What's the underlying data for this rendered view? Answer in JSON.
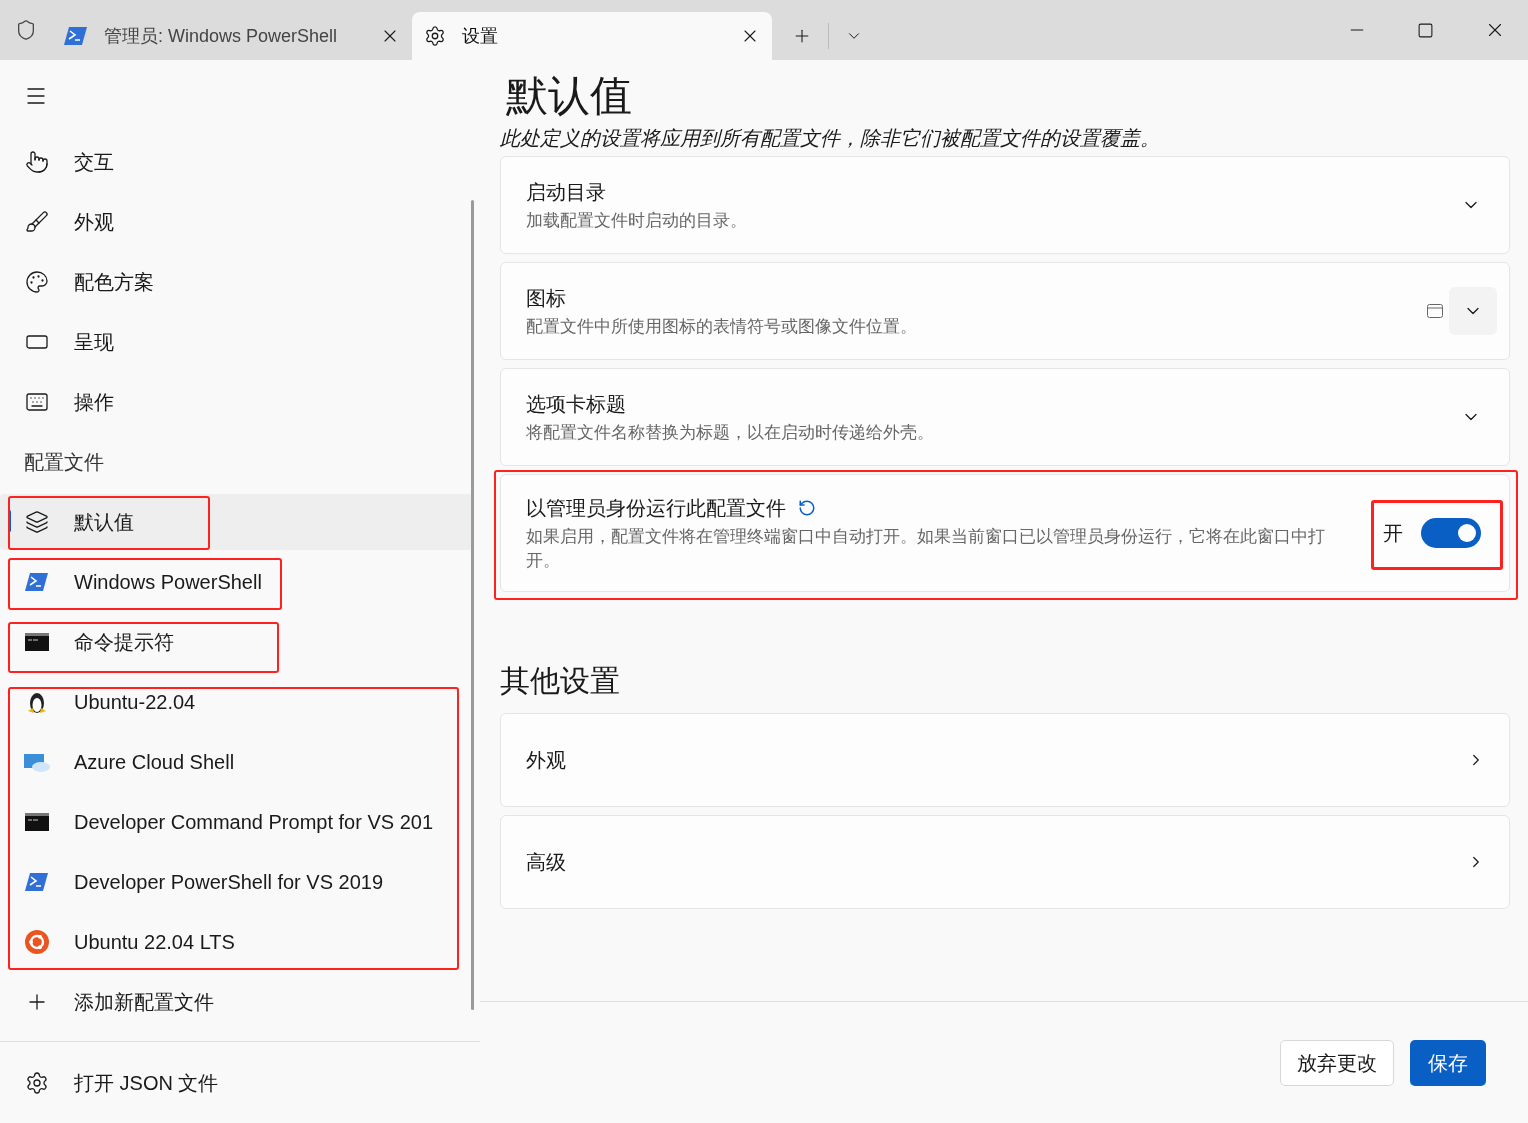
{
  "tabs": [
    {
      "kind": "powershell",
      "title": "管理员: Windows PowerShell",
      "selected": false
    },
    {
      "kind": "settings",
      "title": "设置",
      "selected": true
    }
  ],
  "sidebar": {
    "nav_items": [
      {
        "kind": "pointer",
        "label": "交互"
      },
      {
        "kind": "brush",
        "label": "外观"
      },
      {
        "kind": "palette",
        "label": "配色方案"
      },
      {
        "kind": "screen",
        "label": "呈现"
      },
      {
        "kind": "keyboard",
        "label": "操作"
      }
    ],
    "profiles_header": "配置文件",
    "profiles": [
      {
        "kind": "layers",
        "label": "默认值",
        "selected": true
      },
      {
        "kind": "powershell",
        "label": "Windows PowerShell",
        "selected": false
      },
      {
        "kind": "cmd",
        "label": "命令提示符",
        "selected": false
      },
      {
        "kind": "linux",
        "label": "Ubuntu-22.04",
        "selected": false
      },
      {
        "kind": "azure",
        "label": "Azure Cloud Shell",
        "selected": false
      },
      {
        "kind": "cmd",
        "label": "Developer Command Prompt for VS 201",
        "selected": false
      },
      {
        "kind": "powershell",
        "label": "Developer PowerShell for VS 2019",
        "selected": false
      },
      {
        "kind": "ubuntu",
        "label": "Ubuntu 22.04 LTS",
        "selected": false
      }
    ],
    "add_profile": "添加新配置文件",
    "open_json": "打开 JSON 文件"
  },
  "page": {
    "title": "默认值",
    "subtitle": "此处定义的设置将应用到所有配置文件，除非它们被配置文件的设置覆盖。",
    "settings": [
      {
        "kind": "expander",
        "title": "启动目录",
        "description": "加载配置文件时启动的目录。"
      },
      {
        "kind": "icon_picker",
        "title": "图标",
        "description": "配置文件中所使用图标的表情符号或图像文件位置。"
      },
      {
        "kind": "expander",
        "title": "选项卡标题",
        "description": "将配置文件名称替换为标题，以在启动时传递给外壳。"
      },
      {
        "kind": "toggle",
        "title": "以管理员身份运行此配置文件",
        "description": "如果启用，配置文件将在管理终端窗口中自动打开。如果当前窗口已以管理员身份运行，它将在此窗口中打开。",
        "state_label": "开",
        "on": true
      }
    ],
    "section_title": "其他设置",
    "links": [
      {
        "label": "外观"
      },
      {
        "label": "高级"
      }
    ]
  },
  "footer": {
    "discard": "放弃更改",
    "save": "保存"
  }
}
